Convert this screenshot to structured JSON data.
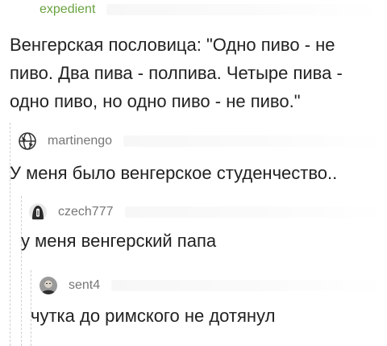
{
  "comments": [
    {
      "username": "expedient",
      "text": "Венгерская пословица: \"Одно пиво - не пиво. Два пива - полпива. Четыре пива - одно пиво, но одно пиво - не пиво.\""
    },
    {
      "username": "martinengo",
      "avatar": "globe-emblem-icon",
      "text": "У меня было венгерское студенчество.."
    },
    {
      "username": "czech777",
      "avatar": "helmet-knight-icon",
      "text": "у меня венгерский папа"
    },
    {
      "username": "sent4",
      "avatar": "portrait-avatar-icon",
      "text": "чутка до римского не дотянул"
    }
  ],
  "colors": {
    "op_username": "#6aa341",
    "username": "#777777",
    "text": "#222222",
    "thread_line": "#cfcfcf"
  }
}
